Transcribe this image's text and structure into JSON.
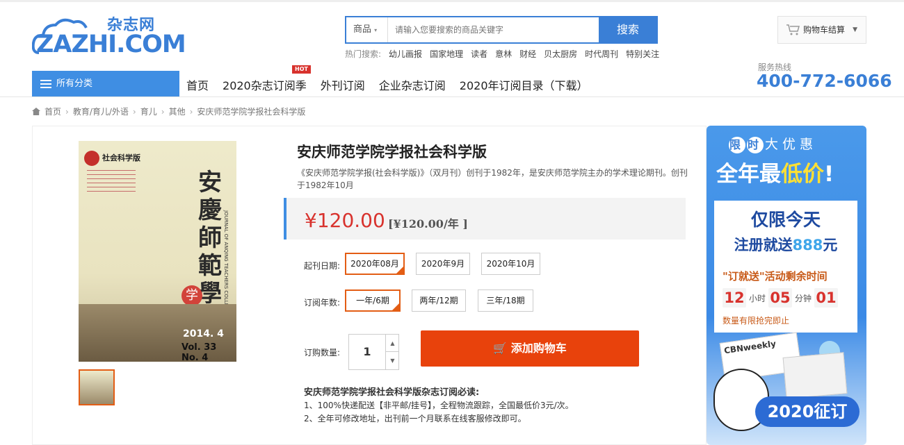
{
  "brand": {
    "logo_cn": "杂志网",
    "logo_en": "ZAZHI.COM"
  },
  "search": {
    "category": "商品",
    "placeholder": "请输入您要搜索的商品关键字",
    "button": "搜索"
  },
  "hot_search": {
    "label": "热门搜索:",
    "items": [
      "幼儿画报",
      "国家地理",
      "读者",
      "意林",
      "财经",
      "贝太厨房",
      "时代周刊",
      "特别关注"
    ]
  },
  "cart": {
    "label": "购物车结算"
  },
  "nav": {
    "all_categories": "所有分类",
    "links": [
      "首页",
      "2020杂志订阅季",
      "外刊订阅",
      "企业杂志订阅",
      "2020年订阅目录（下载）"
    ],
    "hot_badge": "HOT"
  },
  "hotline": {
    "label": "服务热线",
    "number": "400-772-6066"
  },
  "breadcrumb": [
    "首页",
    "教育/育儿/外语",
    "育儿",
    "其他",
    "安庆师范学院学报社会科学版"
  ],
  "product": {
    "title": "安庆师范学院学报社会科学版",
    "desc": "《安庆师范学院学报(社会科学版)》（双月刊）创刊于1982年，是安庆师范学院主办的学术理论期刊。创刊于1982年10月",
    "price": "¥120.00",
    "price_detail": "[¥120.00/年 ]",
    "start_label": "起刊日期:",
    "start_options": [
      "2020年08月",
      "2020年9月",
      "2020年10月"
    ],
    "years_label": "订阅年数:",
    "year_options": [
      "一年/6期",
      "两年/12期",
      "三年/18期"
    ],
    "qty_label": "订购数量:",
    "qty": "1",
    "add_cart": "添加购物车",
    "notes_title": "安庆师范学院学报社会科学版杂志订阅必读:",
    "notes": [
      "1、100%快递配送【非平邮/挂号】，全程物流跟踪，全国最低价3元/次。",
      "2、全年可修改地址，出刊前一个月联系在线客服修改即可。"
    ]
  },
  "cover": {
    "top_label": "社会科学版",
    "calligraphy": "安慶師範學院",
    "xue_bao": "学",
    "year_issue": "2014. 4",
    "vol": "Vol. 33  No. 4",
    "vertical_en": "JOURNAL OF ANQING TEACHERS COLLEGE"
  },
  "promo": {
    "limited": [
      "限",
      "时"
    ],
    "limited_rest": "大优惠",
    "headline_a": "全年最",
    "headline_b": "低价",
    "headline_c": "!",
    "today": "仅限今天",
    "register_a": "注册就送",
    "register_b": "888",
    "register_c": "元",
    "activity": "\"订就送\"活动剩余时间",
    "hours": "12",
    "hours_unit": "小时",
    "minutes": "05",
    "minutes_unit": "分钟",
    "seconds": "01",
    "limited_qty": "数量有限抢完即止",
    "magazine": "CBNweekly",
    "banner": "2020征订"
  }
}
